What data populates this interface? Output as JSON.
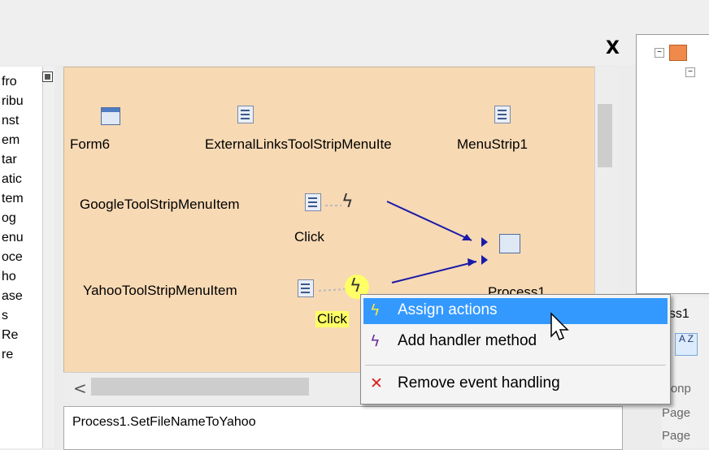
{
  "window": {
    "close_label": "X"
  },
  "left_panel": {
    "items": [
      "fro",
      "ribu",
      "nst",
      "em",
      "tar",
      "atic",
      "tem",
      "og",
      "enu",
      "oce",
      "ho",
      "ase",
      "s",
      "Re",
      "re"
    ]
  },
  "canvas": {
    "components": [
      {
        "label": "Form6",
        "icon": "form-icon"
      },
      {
        "label": "ExternalLinksToolStripMenuIte",
        "icon": "component-icon"
      },
      {
        "label": "MenuStrip1",
        "icon": "component-icon"
      },
      {
        "label": "GoogleToolStripMenuItem",
        "icon": "component-icon"
      },
      {
        "label": "YahooToolStripMenuItem",
        "icon": "component-icon"
      },
      {
        "label": "Process1",
        "icon": "process-icon"
      }
    ],
    "events": [
      {
        "label": "Click"
      },
      {
        "label": "Click"
      }
    ],
    "scroll_left_label": "<"
  },
  "bottom_text": "Process1.SetFileNameToYahoo",
  "right_panel": {
    "props_header": "ess1",
    "sort_label": "A Z",
    "rows": [
      "Nonp",
      "Page",
      "Page"
    ]
  },
  "context_menu": {
    "items": [
      {
        "label": "Assign actions",
        "icon": "lightning-icon",
        "selected": true
      },
      {
        "label": "Add handler method",
        "icon": "add-handler-icon",
        "selected": false
      },
      {
        "label": "Remove event handling",
        "icon": "remove-x-icon",
        "selected": false
      }
    ]
  },
  "colors": {
    "canvas_bg": "#f7d9b4",
    "menu_highlight": "#3399ff",
    "connector": "#1a1aa8",
    "remove_icon": "#d81e1e",
    "event_highlight": "#ffff66"
  }
}
